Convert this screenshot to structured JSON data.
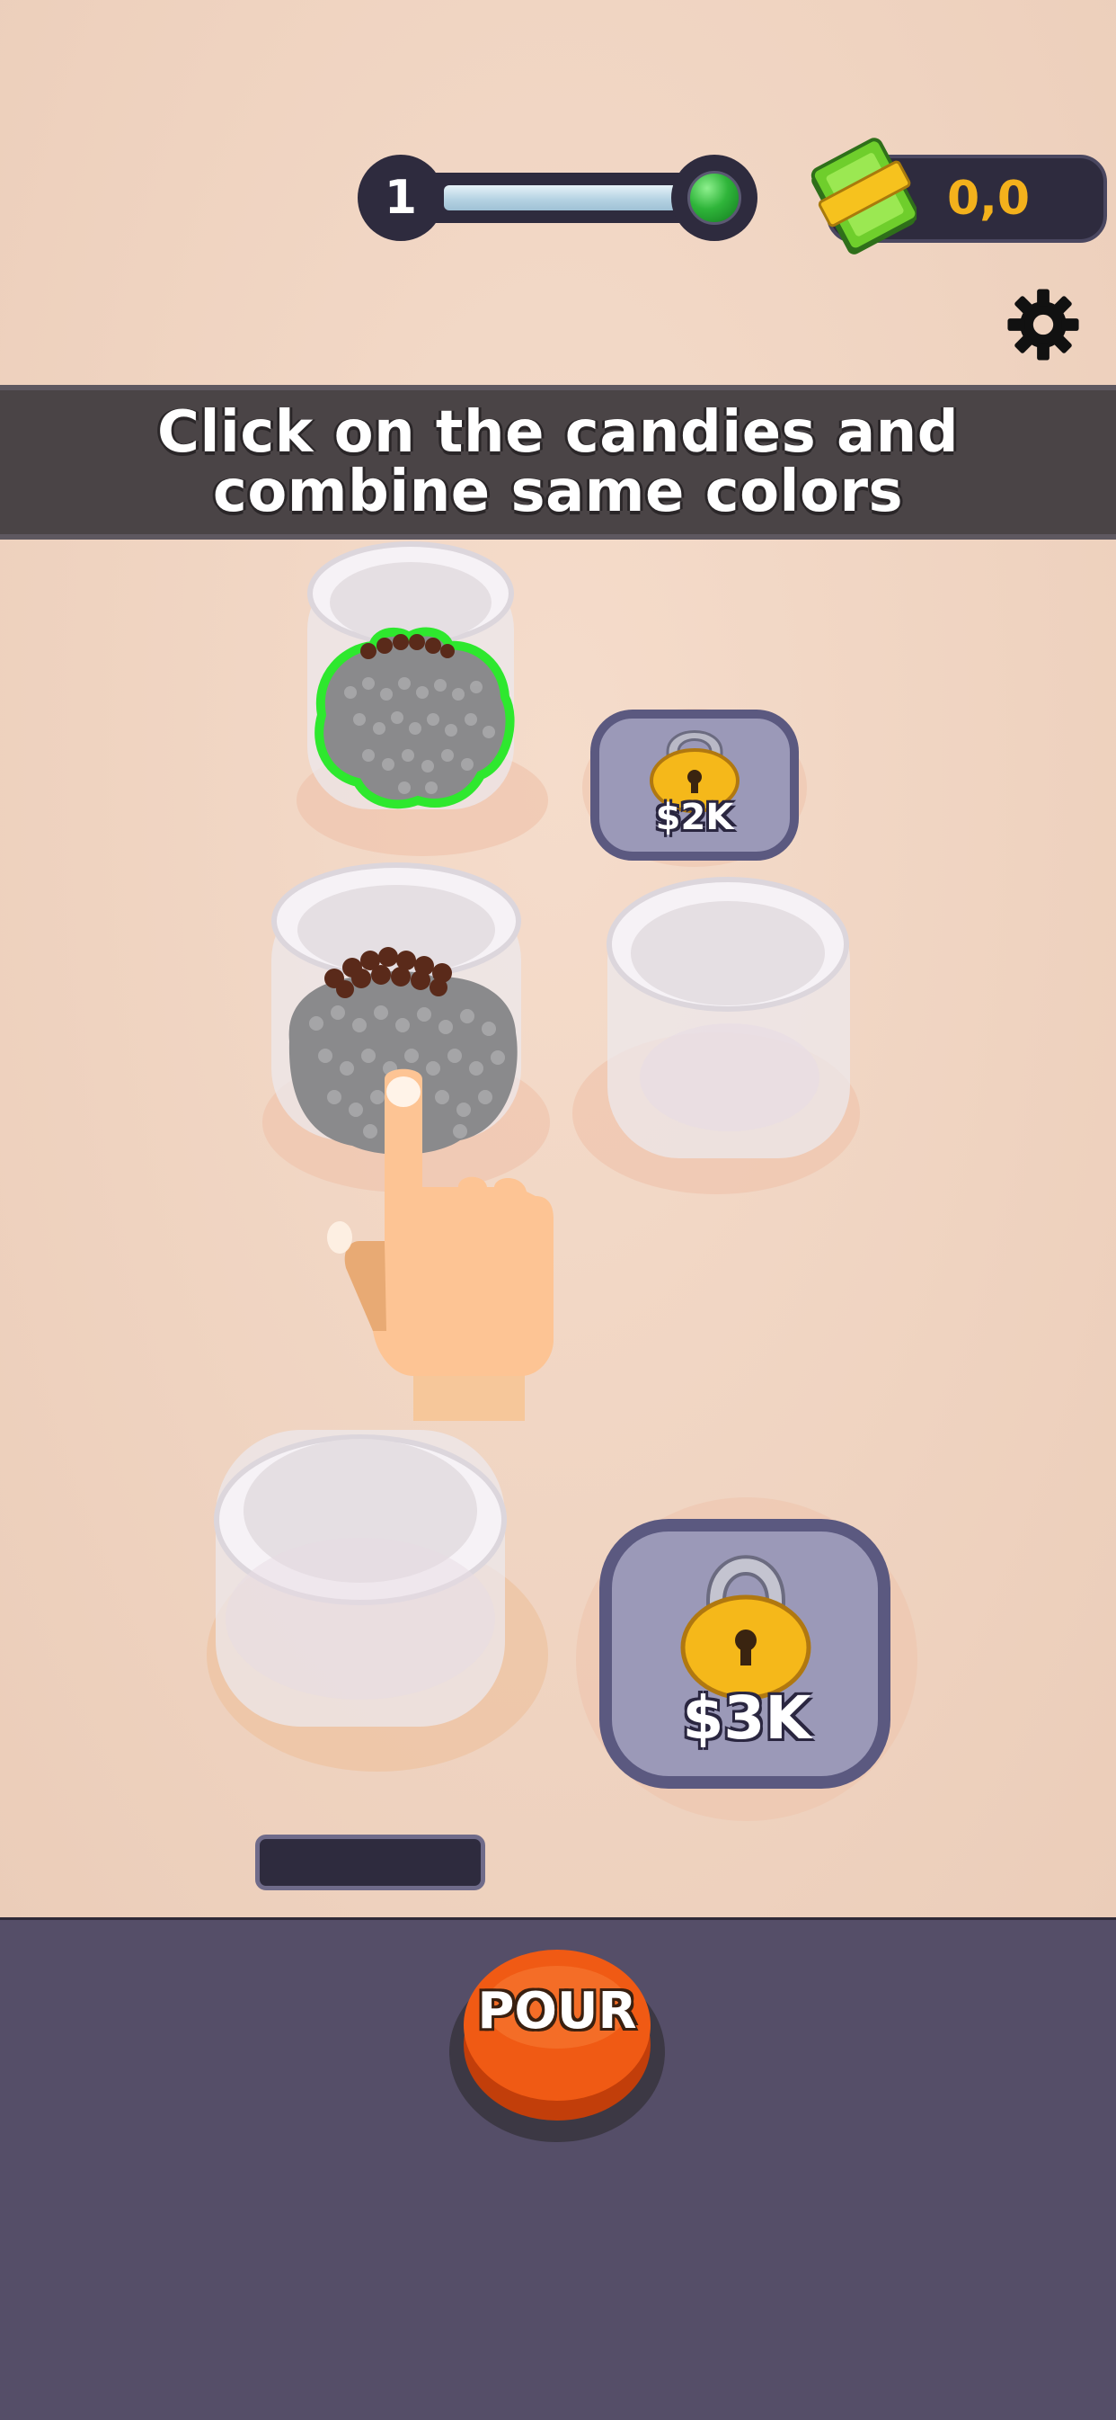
{
  "hud": {
    "level": "1",
    "level_goal_color": "#2fb53a",
    "money": "0,0",
    "money_icon": "cash-stack-icon",
    "settings_icon": "gear-icon"
  },
  "banner": {
    "instruction": "Click on the candies and combine same colors"
  },
  "jars": [
    {
      "id": "jar-1",
      "state": "selected",
      "contents": [
        "gray",
        "brown"
      ]
    },
    {
      "id": "lock-1",
      "state": "locked",
      "price": "$2K"
    },
    {
      "id": "jar-2",
      "state": "filled",
      "contents": [
        "gray",
        "brown"
      ]
    },
    {
      "id": "jar-3",
      "state": "empty"
    },
    {
      "id": "jar-4",
      "state": "empty"
    },
    {
      "id": "lock-2",
      "state": "locked",
      "price": "$3K"
    }
  ],
  "colors": {
    "selection_outline": "#2ee82e",
    "candy_gray": "#8a8a8c",
    "candy_brown": "#5a2a1a",
    "pour_button": "#f05a14",
    "bottom_panel": "#554e68"
  },
  "pour_button": {
    "label": "POUR"
  },
  "tutorial": {
    "hand_icon": "pointing-hand-icon"
  }
}
